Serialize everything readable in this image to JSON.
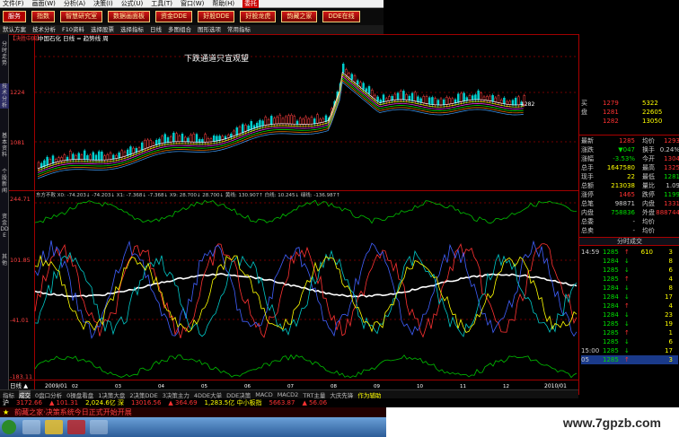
{
  "menu": [
    "文件(F)",
    "画面(W)",
    "分析(A)",
    "决策(I)",
    "公式(U)",
    "工具(T)",
    "窗口(W)",
    "帮助(H)",
    "委托"
  ],
  "toolbar": [
    "服务",
    "指数",
    "智慧研究室",
    "数据画面板",
    "资金DDE",
    "好股DDE",
    "好股龙虎",
    "韵藏之家",
    "DDE在线"
  ],
  "subtool": [
    "默认方案",
    "技术分析",
    "F10资料",
    "选择股票",
    "选择指标",
    "日线",
    "多图组合",
    "图形选项",
    "常用指标"
  ],
  "left_tabs": [
    "分时走势",
    "技术分析",
    "基本资料",
    "个股新闻",
    "资金DDE",
    "其他"
  ],
  "main": {
    "label_top": "【决胜中国】",
    "stock_line": "中国石化 日线  = 趋势线 周",
    "annotation": "下跌通道只宜观望",
    "price_axis": [
      "1224",
      "1081"
    ],
    "mid_label": "1282",
    "indicator_line": "东方不败 X0: -74.203↓ -74.203↓ X1: -7.368↓ -7.368↓ X9: 28.700↓ 28.700↓ 黄线: 130.907↑ 白线: 10.245↓ 绿线: -136.987↑",
    "ind_axis": [
      "244.71",
      "101.85",
      "-41.01",
      "-183.11"
    ],
    "footer_left": "日线 ▲",
    "date_left": "2009/01",
    "date_right": "2010/01",
    "months": [
      "02",
      "03",
      "04",
      "05",
      "06",
      "07",
      "08",
      "09",
      "10",
      "11",
      "12"
    ]
  },
  "orderbook": [
    {
      "label": "买",
      "price": "1279",
      "vol": "5322"
    },
    {
      "label": "盘",
      "price": "1281",
      "vol": "22605"
    },
    {
      "label": "",
      "price": "1282",
      "vol": "13050"
    }
  ],
  "quote": [
    [
      "最新",
      "1285",
      "均价",
      "1293"
    ],
    [
      "涨跌",
      "▼047",
      "换手",
      "0.24%"
    ],
    [
      "涨幅",
      "-3.53%",
      "今开",
      "1304"
    ],
    [
      "总手",
      "1647580",
      "最高",
      "1325"
    ],
    [
      "现手",
      "22",
      "最低",
      "1281"
    ],
    [
      "总额",
      "213038",
      "量比",
      "1.09"
    ],
    [
      "涨停",
      "1465",
      "跌停",
      "1199"
    ],
    [
      "总笔",
      "98871",
      "内盘",
      "1331"
    ],
    [
      "内盘",
      "758836",
      "外盘",
      "888744"
    ],
    [
      "总委",
      "-",
      "均价",
      ""
    ],
    [
      "总卖",
      "-",
      "均价",
      ""
    ]
  ],
  "tick_header": "分时成交",
  "ticks": [
    [
      "14:59",
      "1285",
      "610",
      "3"
    ],
    [
      "",
      "1284",
      "",
      "8"
    ],
    [
      "",
      "1285",
      "",
      "6"
    ],
    [
      "",
      "1285",
      "",
      "4"
    ],
    [
      "",
      "1284",
      "",
      "8"
    ],
    [
      "",
      "1284",
      "",
      "17"
    ],
    [
      "",
      "1284",
      "",
      "4"
    ],
    [
      "",
      "1284",
      "",
      "23"
    ],
    [
      "",
      "1285",
      "",
      "19"
    ],
    [
      "",
      "1285",
      "",
      "1"
    ],
    [
      "",
      "1285",
      "",
      "6"
    ],
    [
      "15:00",
      "1285",
      "",
      "17"
    ],
    [
      "05",
      "1285",
      "",
      "3"
    ]
  ],
  "bottom_tabs": [
    "指标",
    "成交",
    "0盘口分析",
    "0操盘看盘",
    "1决策大盘",
    "2决策DDE",
    "3决策主力",
    "4DDE大单",
    "DDE决策",
    "MACD",
    "MACD2",
    "TRT主量",
    "大庆先锋",
    "作为辅助"
  ],
  "index_bar": [
    "沪",
    "3172.66",
    "▲ 101.31",
    "2,024.6亿 深",
    "13016.56",
    "▲ 364.69",
    "1,283.5亿 中小板指",
    "5663.87",
    "▲ 56.06"
  ],
  "ticker": "韵藏之家·决策系统今日正式开始开展",
  "watermark": "www.7gpzb.com",
  "colors": {
    "up": "#ff3232",
    "down": "#00e000",
    "yellow": "#ffff00",
    "cyan": "#00c8c8",
    "white": "#ffffff",
    "red_border": "#b00000"
  }
}
